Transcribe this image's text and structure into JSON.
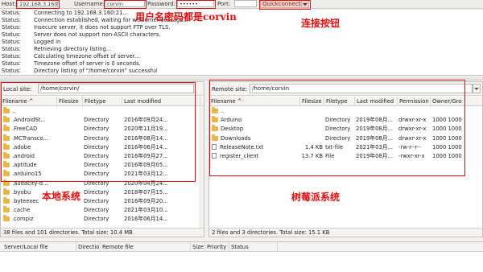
{
  "quickconnect": {
    "host_label": "Host:",
    "host_value": "192.168.3.160",
    "username_label": "Username:",
    "username_value": "corvin",
    "password_label": "Password:",
    "password_value": "••••••",
    "port_label": "Port:",
    "port_value": "",
    "connect_label": "Quickconnect"
  },
  "annotations": {
    "credentials": "用户名密码都是corvin",
    "connect_button": "连接按钮",
    "local_system": "本地系统",
    "remote_system": "树莓派系统"
  },
  "log": [
    {
      "key": "Status:",
      "text": "Connecting to 192.168.3.160:21..."
    },
    {
      "key": "Status:",
      "text": "Connection established, waiting for welcome message..."
    },
    {
      "key": "Status:",
      "text": "Insecure server, it does not support FTP over TLS."
    },
    {
      "key": "Status:",
      "text": "Server does not support non-ASCII characters."
    },
    {
      "key": "Status:",
      "text": "Logged in"
    },
    {
      "key": "Status:",
      "text": "Retrieving directory listing..."
    },
    {
      "key": "Status:",
      "text": "Calculating timezone offset of server..."
    },
    {
      "key": "Status:",
      "text": "Timezone offset of server is 0 seconds."
    },
    {
      "key": "Status:",
      "text": "Directory listing of \"/home/corvin\" successful"
    }
  ],
  "local": {
    "site_label": "Local site:",
    "path": "/home/corvin/",
    "columns": [
      "Filename ^",
      "Filesize",
      "Filetype",
      "Last modified"
    ],
    "rows": [
      {
        "name": "..",
        "size": "",
        "type": "",
        "modified": "",
        "kind": "folder"
      },
      {
        "name": ".AndroidSt...",
        "size": "",
        "type": "Directory",
        "modified": "2016年09月24...",
        "kind": "folder"
      },
      {
        "name": ".FreeCAD",
        "size": "",
        "type": "Directory",
        "modified": "2020年11月19...",
        "kind": "folder"
      },
      {
        "name": ".MCTransco...",
        "size": "",
        "type": "Directory",
        "modified": "2016年08月14...",
        "kind": "folder"
      },
      {
        "name": ".adobe",
        "size": "",
        "type": "Directory",
        "modified": "2016年06月14...",
        "kind": "folder"
      },
      {
        "name": ".android",
        "size": "",
        "type": "Directory",
        "modified": "2016年09月27...",
        "kind": "folder"
      },
      {
        "name": ".aptitude",
        "size": "",
        "type": "Directory",
        "modified": "2016年09月05...",
        "kind": "folder"
      },
      {
        "name": ".arduino15",
        "size": "",
        "type": "Directory",
        "modified": "2021年03月12...",
        "kind": "folder"
      },
      {
        "name": ".audacity-d...",
        "size": "",
        "type": "Directory",
        "modified": "2020年04月24...",
        "kind": "folder"
      },
      {
        "name": ".byobu",
        "size": "",
        "type": "Directory",
        "modified": "2018年07月15...",
        "kind": "folder"
      },
      {
        "name": ".byteexec",
        "size": "",
        "type": "Directory",
        "modified": "2016年09月20...",
        "kind": "folder"
      },
      {
        "name": ".cache",
        "size": "",
        "type": "Directory",
        "modified": "2021年03月10...",
        "kind": "folder"
      },
      {
        "name": ".compiz",
        "size": "",
        "type": "Directory",
        "modified": "2016年06月14...",
        "kind": "folder"
      }
    ],
    "status": "38 files and 101 directories. Total size: 10.4 MB"
  },
  "remote": {
    "site_label": "Remote site:",
    "path": "/home/corvin",
    "columns": [
      "Filename ^",
      "Filesize",
      "Filetype",
      "Last modified",
      "Permission",
      "Owner/Gro"
    ],
    "rows": [
      {
        "name": "..",
        "size": "",
        "type": "",
        "modified": "",
        "perm": "",
        "owner": "",
        "kind": "folder"
      },
      {
        "name": "Arduino",
        "size": "",
        "type": "Directory",
        "modified": "2019年08月...",
        "perm": "drwxr-xr-x",
        "owner": "1000 1000",
        "kind": "folder"
      },
      {
        "name": "Desktop",
        "size": "",
        "type": "Directory",
        "modified": "2019年08月...",
        "perm": "drwxr-xr-x",
        "owner": "1000 1000",
        "kind": "folder"
      },
      {
        "name": "Downloads",
        "size": "",
        "type": "Directory",
        "modified": "2019年08月...",
        "perm": "drwxr-xr-x",
        "owner": "1000 1000",
        "kind": "folder"
      },
      {
        "name": "ReleaseNote.txt",
        "size": "1.4 KB",
        "type": "txt-file",
        "modified": "2021年03月...",
        "perm": "-rw-r--r--",
        "owner": "1000 1000",
        "kind": "file"
      },
      {
        "name": "register_client",
        "size": "13.7 KB",
        "type": "File",
        "modified": "2019年08月...",
        "perm": "-rwxr-xr-x",
        "owner": "1000 1000",
        "kind": "file"
      }
    ],
    "status": "2 files and 3 directories. Total size: 15.1 KB"
  },
  "queue": {
    "columns": [
      "Server/Local file",
      "Directio",
      "Remote file",
      "Size",
      "Priority",
      "Status"
    ]
  },
  "colors": {
    "annotation": "#e01010",
    "folder": "#e9b64a",
    "connect_bg": "#f4d2c9"
  }
}
